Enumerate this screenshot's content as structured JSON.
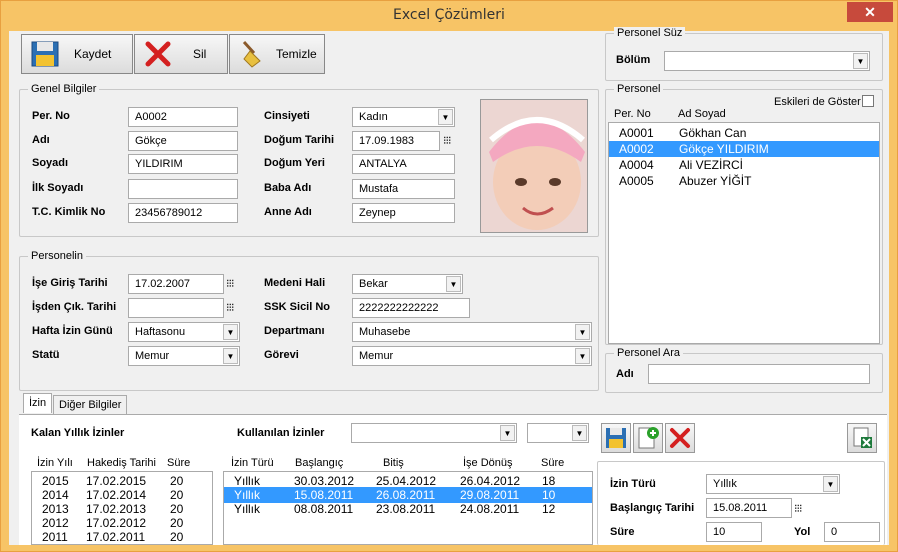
{
  "window": {
    "title": "Excel Çözümleri",
    "close": "✕"
  },
  "toolbar": {
    "save": "Kaydet",
    "delete": "Sil",
    "clear": "Temizle"
  },
  "genel": {
    "title": "Genel Bilgiler",
    "per_no_label": "Per. No",
    "per_no": "A0002",
    "adi_label": "Adı",
    "adi": "Gökçe",
    "soyadi_label": "Soyadı",
    "soyadi": "YILDIRIM",
    "ilk_soyadi_label": "İlk Soyadı",
    "ilk_soyadi": "",
    "tc_label": "T.C. Kimlik No",
    "tc": "23456789012",
    "cinsiyet_label": "Cinsiyeti",
    "cinsiyet": "Kadın",
    "dogum_tarihi_label": "Doğum Tarihi",
    "dogum_tarihi": "17.09.1983",
    "dogum_yeri_label": "Doğum Yeri",
    "dogum_yeri": "ANTALYA",
    "baba_label": "Baba Adı",
    "baba": "Mustafa",
    "anne_label": "Anne Adı",
    "anne": "Zeynep"
  },
  "personelin": {
    "title": "Personelin",
    "giris_label": "İşe Giriş Tarihi",
    "giris": "17.02.2007",
    "cikis_label": "İşden Çık. Tarihi",
    "cikis": "",
    "izin_gunu_label": "Hafta İzin Günü",
    "izin_gunu": "Haftasonu",
    "statu_label": "Statü",
    "statu": "Memur",
    "medeni_label": "Medeni Hali",
    "medeni": "Bekar",
    "ssk_label": "SSK Sicil  No",
    "ssk": "2222222222222",
    "departman_label": "Departmanı",
    "departman": "Muhasebe",
    "gorevi_label": "Görevi",
    "gorevi": "Memur"
  },
  "personel_suz": {
    "title": "Personel Süz",
    "bolum_label": "Bölüm",
    "bolum": ""
  },
  "personel": {
    "title": "Personel",
    "eskiler": "Eskileri de Göster",
    "col_no": "Per. No",
    "col_name": "Ad Soyad",
    "rows": [
      {
        "no": "A0001",
        "name": "Gökhan Can"
      },
      {
        "no": "A0002",
        "name": "Gökçe YILDIRIM"
      },
      {
        "no": "A0004",
        "name": "Ali VEZİRCİ"
      },
      {
        "no": "A0005",
        "name": "Abuzer YİĞİT"
      }
    ]
  },
  "personel_ara": {
    "title": "Personel Ara",
    "adi_label": "Adı",
    "adi": ""
  },
  "tabs": {
    "izin": "İzin",
    "diger": "Diğer Bilgiler"
  },
  "izin": {
    "kalan_label": "Kalan Yıllık İzinler",
    "kullanilan_label": "Kullanılan İzinler",
    "kalan_headers": {
      "yil": "İzin Yılı",
      "hakedis": "Hakediş Tarihi",
      "sure": "Süre"
    },
    "kalan_rows": [
      {
        "yil": "2015",
        "tarih": "17.02.2015",
        "sure": "20"
      },
      {
        "yil": "2014",
        "tarih": "17.02.2014",
        "sure": "20"
      },
      {
        "yil": "2013",
        "tarih": "17.02.2013",
        "sure": "20"
      },
      {
        "yil": "2012",
        "tarih": "17.02.2012",
        "sure": "20"
      },
      {
        "yil": "2011",
        "tarih": "17.02.2011",
        "sure": "20"
      }
    ],
    "kul_headers": {
      "tur": "İzin Türü",
      "bas": "Başlangıç",
      "bitis": "Bitiş",
      "donus": "İşe Dönüş",
      "sure": "Süre"
    },
    "kul_rows": [
      {
        "tur": "Yıllık",
        "bas": "30.03.2012",
        "bitis": "25.04.2012",
        "donus": "26.04.2012",
        "sure": "18"
      },
      {
        "tur": "Yıllık",
        "bas": "15.08.2011",
        "bitis": "26.08.2011",
        "donus": "29.08.2011",
        "sure": "10"
      },
      {
        "tur": "Yıllık",
        "bas": "08.08.2011",
        "bitis": "23.08.2011",
        "donus": "24.08.2011",
        "sure": "12"
      }
    ],
    "form": {
      "tur_label": "İzin Türü",
      "tur": "Yıllık",
      "bas_label": "Başlangıç Tarihi",
      "bas": "15.08.2011",
      "sure_label": "Süre",
      "sure": "10",
      "yol_label": "Yol",
      "yol": "0"
    }
  }
}
